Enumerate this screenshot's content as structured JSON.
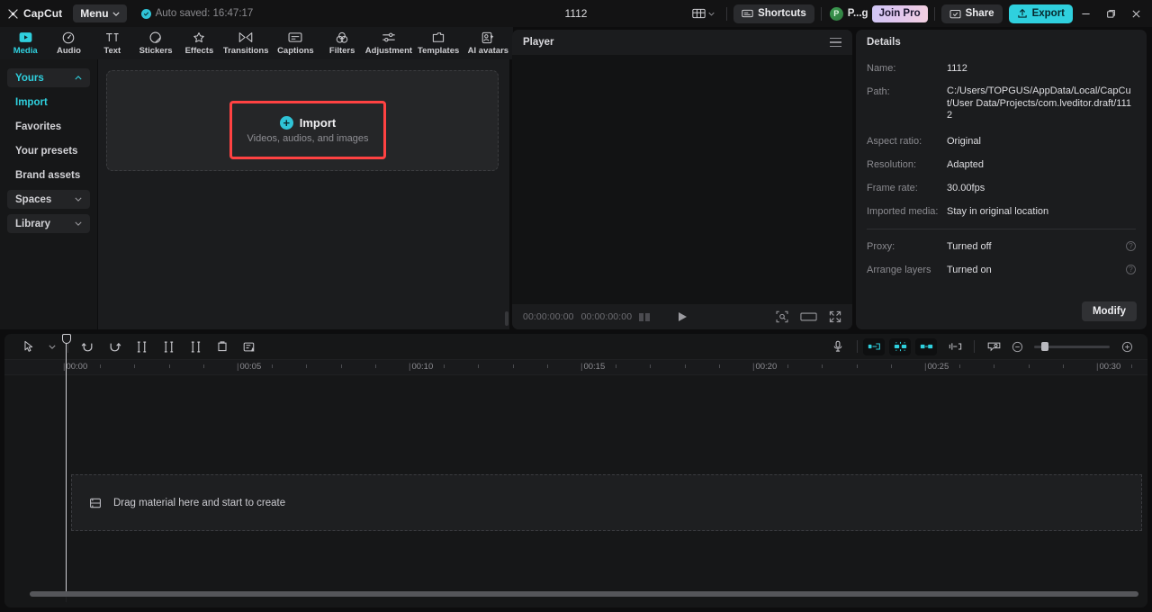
{
  "app": {
    "brand": "CapCut",
    "menu_label": "Menu",
    "project_title": "1112"
  },
  "titlebar": {
    "autosave_text": "Auto saved: 16:47:17",
    "layout_icon": "layout-icon",
    "shortcuts_label": "Shortcuts",
    "account_initial": "P",
    "account_name": "P...g",
    "join_pro_label": "Join Pro",
    "share_label": "Share",
    "export_label": "Export",
    "minimize_label": "Minimize",
    "maximize_label": "Restore",
    "close_label": "Close"
  },
  "tabs": [
    {
      "label": "Media",
      "icon": "media-icon",
      "active": true
    },
    {
      "label": "Audio",
      "icon": "audio-icon",
      "active": false
    },
    {
      "label": "Text",
      "icon": "text-icon",
      "active": false
    },
    {
      "label": "Stickers",
      "icon": "stickers-icon",
      "active": false
    },
    {
      "label": "Effects",
      "icon": "effects-icon",
      "active": false
    },
    {
      "label": "Transitions",
      "icon": "transitions-icon",
      "active": false
    },
    {
      "label": "Captions",
      "icon": "captions-icon",
      "active": false
    },
    {
      "label": "Filters",
      "icon": "filters-icon",
      "active": false
    },
    {
      "label": "Adjustment",
      "icon": "adjustment-icon",
      "active": false
    },
    {
      "label": "Templates",
      "icon": "templates-icon",
      "active": false
    },
    {
      "label": "AI avatars",
      "icon": "ai-avatars-icon",
      "active": false
    }
  ],
  "sidebar": {
    "items": [
      {
        "label": "Yours",
        "type": "group",
        "selected": true,
        "chevron": "up"
      },
      {
        "label": "Import",
        "type": "sub",
        "highlight": true
      },
      {
        "label": "Favorites",
        "type": "sub",
        "highlight": false
      },
      {
        "label": "Your presets",
        "type": "sub",
        "highlight": false
      },
      {
        "label": "Brand assets",
        "type": "sub",
        "highlight": false
      },
      {
        "label": "Spaces",
        "type": "group",
        "selected": false,
        "chevron": "down"
      },
      {
        "label": "Library",
        "type": "group",
        "selected": false,
        "chevron": "down"
      }
    ]
  },
  "media": {
    "import_title": "Import",
    "import_subtitle": "Videos, audios, and images",
    "plus": "+"
  },
  "player": {
    "title": "Player",
    "current_time": "00:00:00:00",
    "total_time": "00:00:00:00",
    "play_label": "Play",
    "crop_label": "Crop",
    "ratio_label": "Ratio",
    "fullscreen_label": "Full screen"
  },
  "details": {
    "title": "Details",
    "rows": [
      {
        "label": "Name:",
        "value": "1112"
      },
      {
        "label": "Path:",
        "value": "C:/Users/TOPGUS/AppData/Local/CapCut/User Data/Projects/com.lveditor.draft/1112"
      },
      {
        "label": "Aspect ratio:",
        "value": "Original"
      },
      {
        "label": "Resolution:",
        "value": "Adapted"
      },
      {
        "label": "Frame rate:",
        "value": "30.00fps"
      },
      {
        "label": "Imported media:",
        "value": "Stay in original location"
      }
    ],
    "settings": [
      {
        "label": "Proxy:",
        "value": "Turned off",
        "help": "?"
      },
      {
        "label": "Arrange layers",
        "value": "Turned on",
        "help": "?"
      }
    ],
    "modify_label": "Modify"
  },
  "timeline": {
    "tools": [
      {
        "name": "select-tool",
        "icon": "cursor-icon"
      },
      {
        "name": "select-dropdown",
        "icon": "chevron-down-icon"
      },
      {
        "name": "undo-button",
        "icon": "undo-icon"
      },
      {
        "name": "redo-button",
        "icon": "redo-icon"
      },
      {
        "name": "split-button",
        "icon": "split-icon"
      },
      {
        "name": "trim-left-button",
        "icon": "trim-left-icon"
      },
      {
        "name": "trim-right-button",
        "icon": "trim-right-icon"
      },
      {
        "name": "delete-button",
        "icon": "trash-icon"
      },
      {
        "name": "freeze-button",
        "icon": "freeze-frame-icon"
      }
    ],
    "right_tools": [
      {
        "name": "voiceover-button",
        "icon": "microphone-icon",
        "active": false
      },
      {
        "name": "auto-snap-left-button",
        "icon": "snap-left-icon",
        "active": true
      },
      {
        "name": "auto-snap-center-button",
        "icon": "snap-center-icon",
        "active": true
      },
      {
        "name": "auto-snap-right-button",
        "icon": "snap-right-icon",
        "active": true
      },
      {
        "name": "magnet-button",
        "icon": "adsorption-icon",
        "active": false
      },
      {
        "name": "preview-button",
        "icon": "preview-icon",
        "active": false
      }
    ],
    "zoom_out_label": "-",
    "zoom_in_label": "+",
    "ruler_labels": [
      "00:00",
      "00:05",
      "00:10",
      "00:15",
      "00:20",
      "00:25",
      "00:30"
    ],
    "dropzone_text": "Drag material here and start to create",
    "dropzone_icon": "filmstrip-icon"
  },
  "colors": {
    "accent": "#2fd0de",
    "highlight_box": "#ff4242",
    "bg": "#0d0d0e",
    "panel": "#1b1c1e"
  }
}
